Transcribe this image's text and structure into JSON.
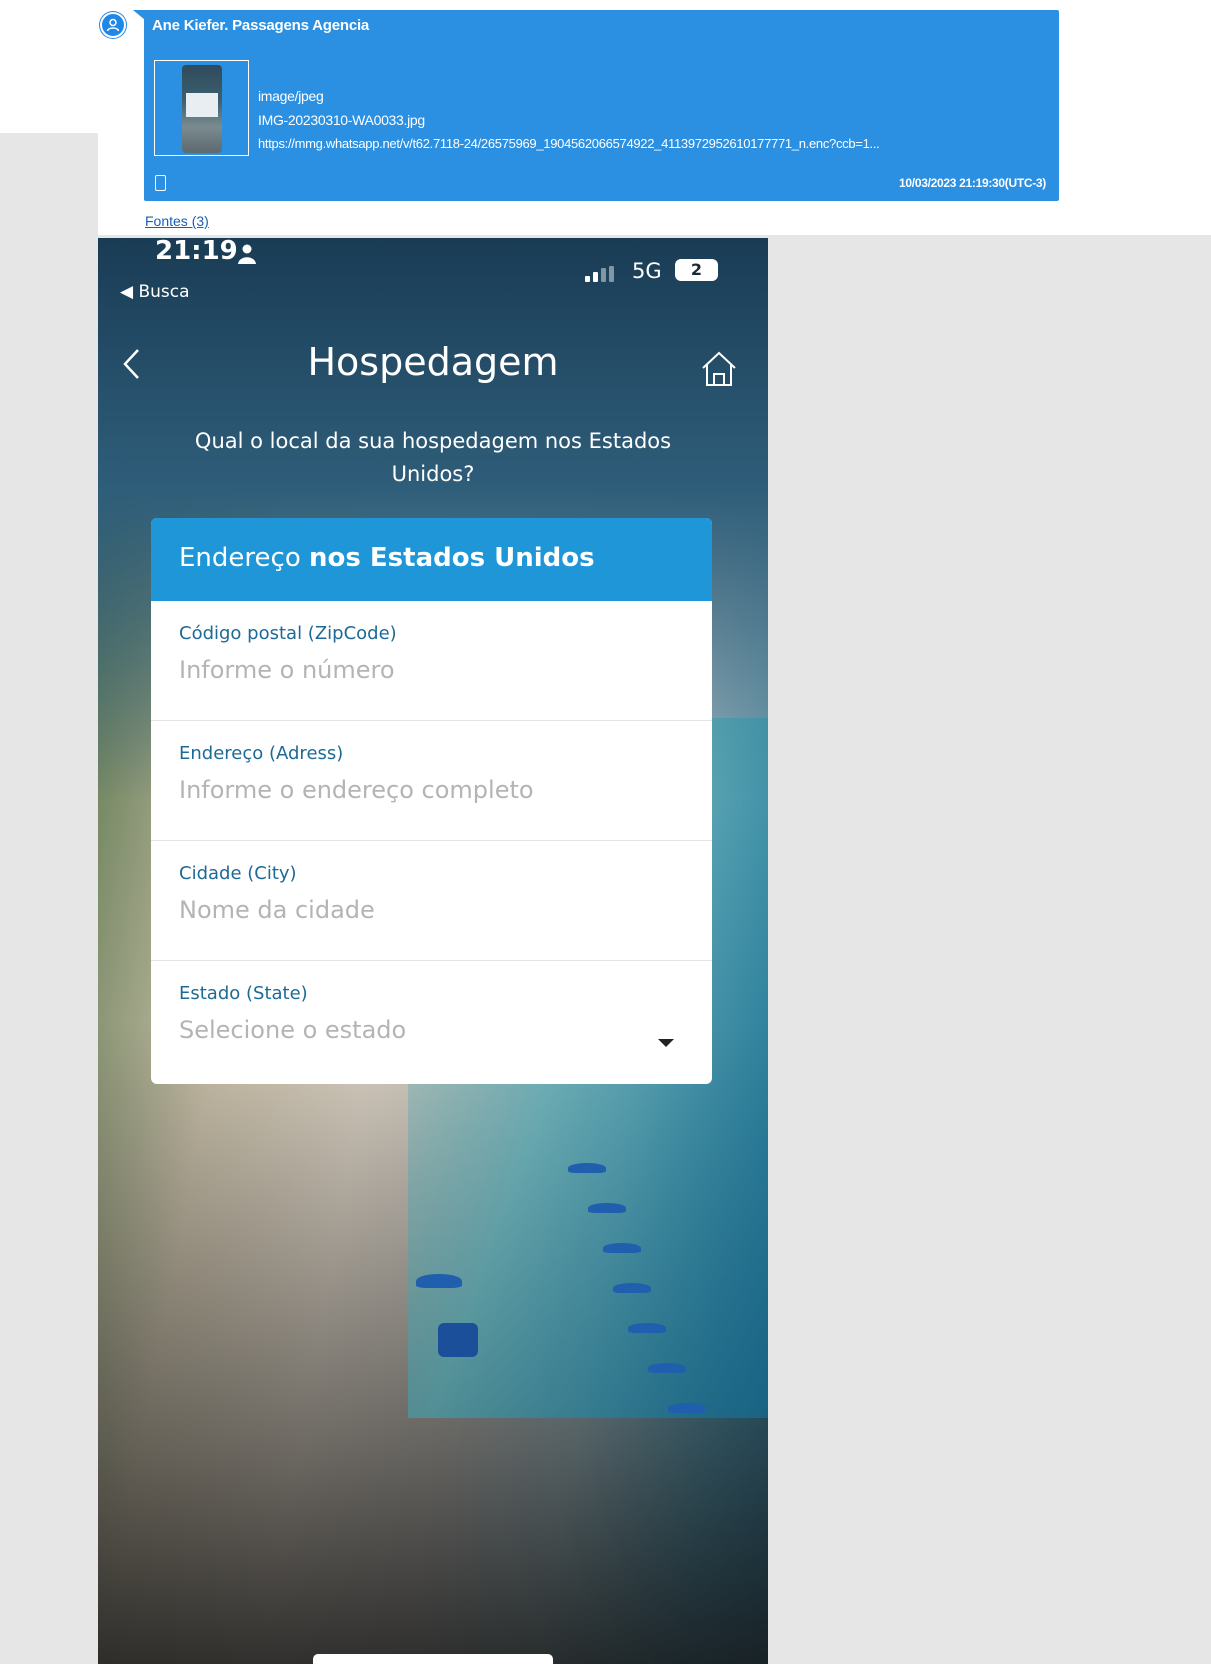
{
  "report": {
    "sender": "Ane Kiefer. Passagens Agencia",
    "attachment_type": "image/jpeg",
    "attachment_name": "IMG-20230310-WA0033.jpg",
    "attachment_url": "https://mmg.whatsapp.net/v/t62.7118-24/26575969_1904562066574922_4113972952610177771_n.enc?ccb=1...",
    "timestamp": "10/03/2023 21:19:30(UTC-3)",
    "sources_link": "Fontes (3)"
  },
  "status_bar": {
    "time": "21:19",
    "back_app": "◀ Busca",
    "network": "5G",
    "battery": "2"
  },
  "nav": {
    "title": "Hospedagem"
  },
  "question": "Qual o local da sua hospedagem nos Estados Unidos?",
  "form": {
    "header_normal": "Endereço ",
    "header_bold": "nos Estados Unidos",
    "fields": [
      {
        "label": "Código postal (ZipCode)",
        "placeholder": "Informe o número"
      },
      {
        "label": "Endereço (Adress)",
        "placeholder": "Informe o endereço completo"
      },
      {
        "label": "Cidade (City)",
        "placeholder": "Nome da cidade"
      },
      {
        "label": "Estado (State)",
        "placeholder": "Selecione o estado"
      }
    ]
  },
  "colors": {
    "bubble": "#2b8fe2",
    "form_header": "#1e96d8",
    "field_label": "#1d6a96"
  }
}
